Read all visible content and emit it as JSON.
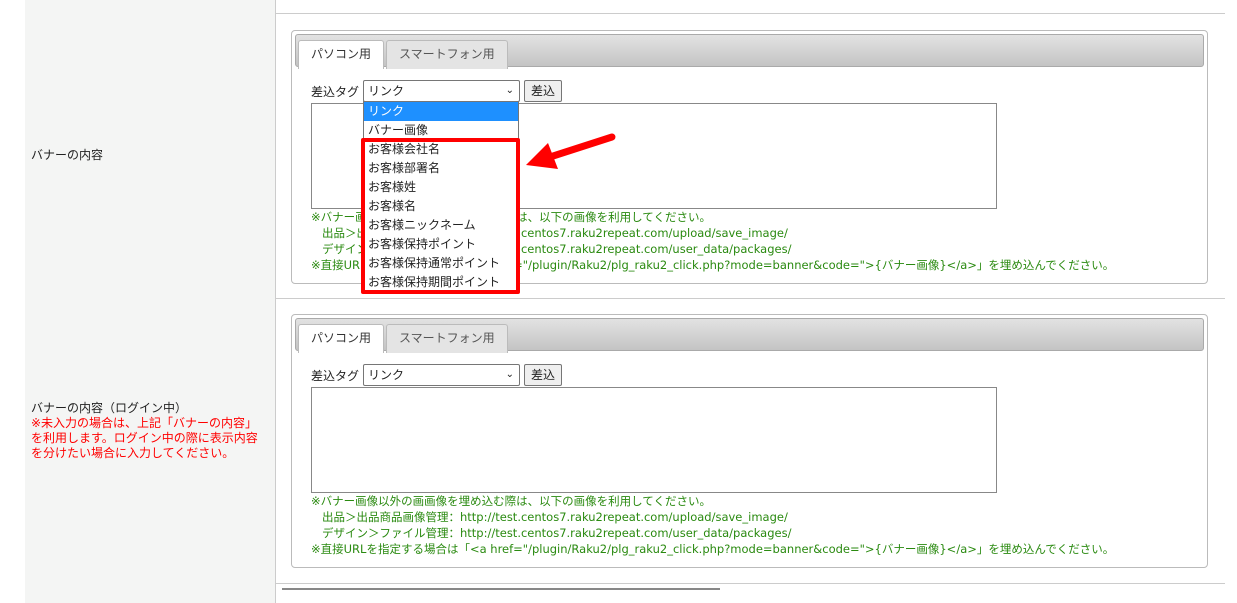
{
  "rows": [
    {
      "label": "バナーの内容",
      "note": "",
      "tabs": [
        "パソコン用",
        "スマートフォン用"
      ],
      "tag_label": "差込タグ",
      "tag_value": "リンク",
      "insert_btn": "差込"
    },
    {
      "label": "バナーの内容（ログイン中）",
      "note": "※未入力の場合は、上記「バナーの内容」を利用します。ログイン中の際に表示内容を分けたい場合に入力してください。",
      "tabs": [
        "パソコン用",
        "スマートフォン用"
      ],
      "tag_label": "差込タグ",
      "tag_value": "リンク",
      "insert_btn": "差込"
    }
  ],
  "notes": [
    "※バナー画像以外の画画像を埋め込む際は、以下の画像を利用してください。",
    "出品＞出品商品画像管理：http://test.centos7.raku2repeat.com/upload/save_image/",
    "デザイン＞ファイル管理：http://test.centos7.raku2repeat.com/user_data/packages/",
    "※直接URLを指定する場合は「<a href=\"/plugin/Raku2/plg_raku2_click.php?mode=banner&code=\">{バナー画像}</a>」を埋め込んでください。"
  ],
  "dropdown_options": [
    "リンク",
    "バナー画像",
    "お客様会社名",
    "お客様部署名",
    "お客様姓",
    "お客様名",
    "お客様ニックネーム",
    "お客様保持ポイント",
    "お客様保持通常ポイント",
    "お客様保持期間ポイント"
  ],
  "colors": {
    "highlight": "#ff0000",
    "selected": "#1e90ff",
    "note": "#2a8a10"
  }
}
